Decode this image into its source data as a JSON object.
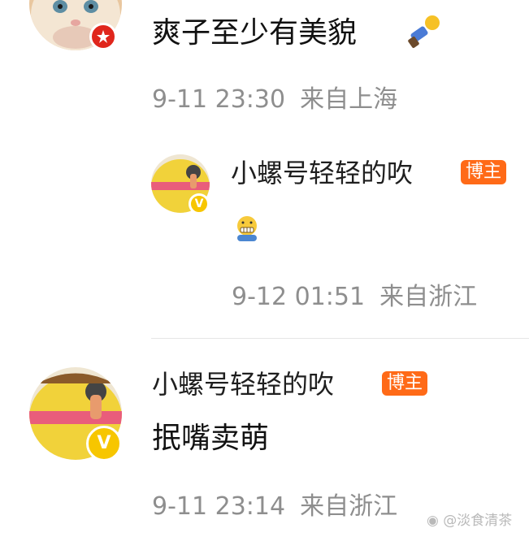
{
  "comments": [
    {
      "text": "爽子至少有美貌",
      "emoji": "hammer-icon",
      "time": "9-11 23:30",
      "location": "来自上海",
      "avatar": "cat-avatar",
      "badge_color": "#e0261c"
    },
    {
      "username": "小螺号轻轻的吹",
      "host_tag": "博主",
      "emoji": "grimace-hug-emoji",
      "time": "9-12 01:51",
      "location": "来自浙江",
      "avatar": "cartoon-avatar",
      "badge_color": "#f7c600"
    },
    {
      "username": "小螺号轻轻的吹",
      "host_tag": "博主",
      "text": "抿嘴卖萌",
      "time": "9-11 23:14",
      "location": "来自浙江",
      "avatar": "cartoon-avatar",
      "badge_color": "#f7c600"
    }
  ],
  "watermark": "@淡食清茶",
  "colors": {
    "host_tag_bg": "#ff6a17",
    "meta_text": "#8e8e8e"
  }
}
